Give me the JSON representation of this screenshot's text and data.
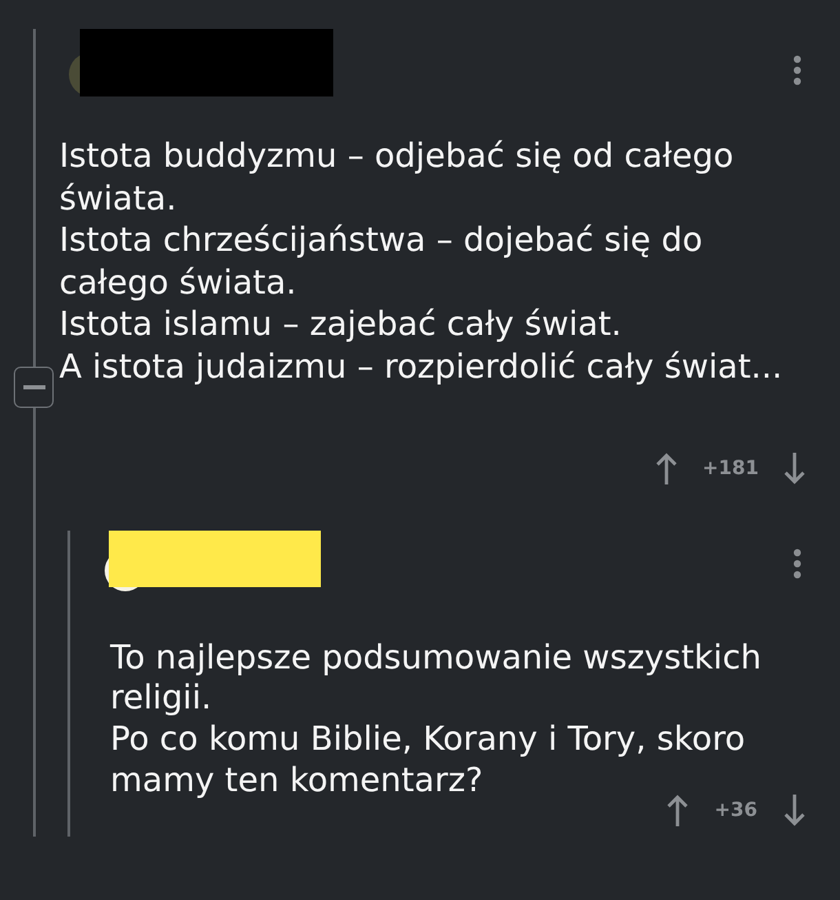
{
  "comments": [
    {
      "redaction": {
        "color": "#000000"
      },
      "expanded": true,
      "body": [
        "Istota buddyzmu – odjebać się od całego świata.",
        "Istota chrześcijaństwa – dojebać się do całego świata.",
        "Istota islamu – zajebać cały świat.",
        "A istota judaizmu – rozpierdolić cały świat..."
      ],
      "score": "+181",
      "replies": [
        {
          "redaction": {
            "color": "#ffe94a"
          },
          "body": [
            "To najlepsze podsumowanie wszystkich religii.",
            "Po co komu Biblie, Korany i Tory, skoro mamy ten komentarz?"
          ],
          "score": "+36"
        }
      ]
    }
  ]
}
